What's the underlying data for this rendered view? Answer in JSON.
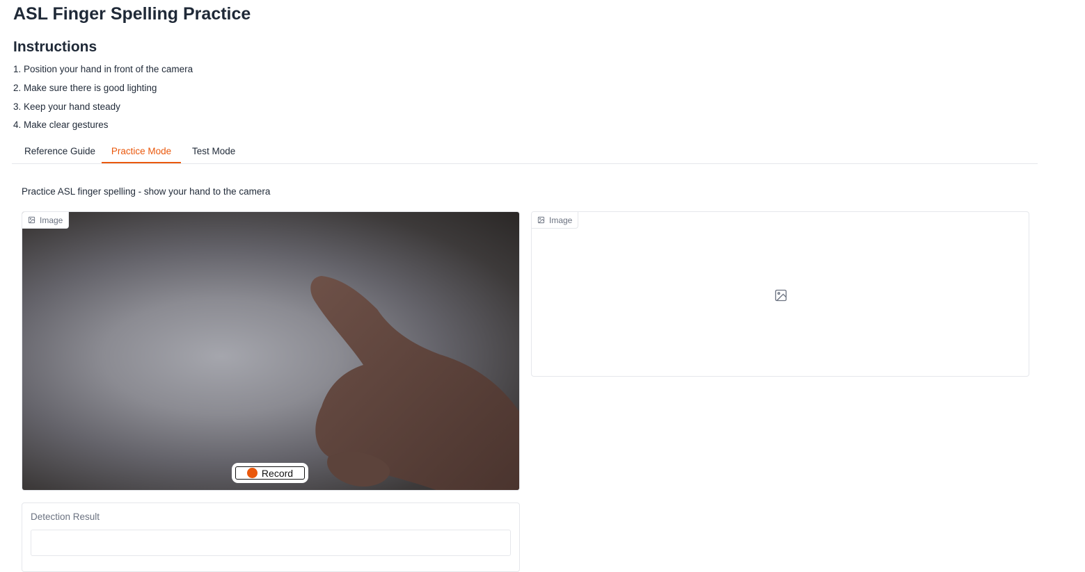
{
  "app": {
    "title": "ASL Finger Spelling Practice"
  },
  "instructions": {
    "heading": "Instructions",
    "items": [
      "1. Position your hand in front of the camera",
      "2. Make sure there is good lighting",
      "3. Keep your hand steady",
      "4. Make clear gestures"
    ]
  },
  "tabs": [
    "Reference Guide",
    "Practice Mode",
    "Test Mode"
  ],
  "active_tab": "Practice Mode",
  "practice": {
    "description": "Practice ASL finger spelling - show your hand to the camera",
    "input_image": {
      "label": "Image",
      "icon": "image-icon"
    },
    "output_image": {
      "label": "Image",
      "icon": "image-icon"
    },
    "record_label": "Record",
    "detection": {
      "label": "Detection Result",
      "value": ""
    }
  },
  "colors": {
    "accent": "#ea580c",
    "border": "#e5e7eb",
    "muted": "#6b7280"
  }
}
